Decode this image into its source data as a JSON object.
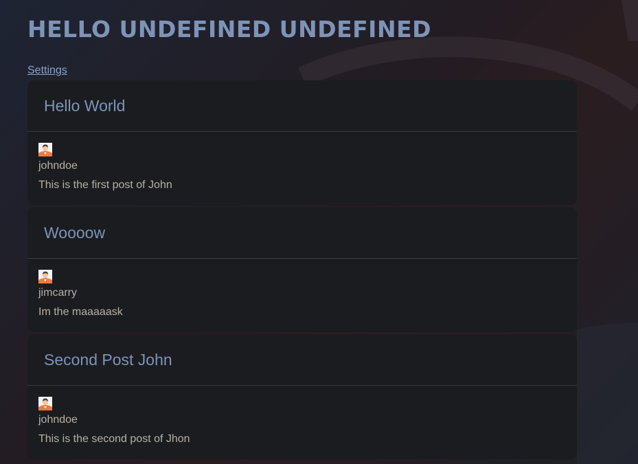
{
  "header": {
    "title": "HELLO UNDEFINED UNDEFINED",
    "settings_link": "Settings"
  },
  "posts": [
    {
      "title": "Hello World",
      "username": "johndoe",
      "content": "This is the first post of John",
      "avatar_icon": "user-avatar-icon"
    },
    {
      "title": "Woooow",
      "username": "jimcarry",
      "content": "Im the maaaaask",
      "avatar_icon": "user-avatar-icon"
    },
    {
      "title": "Second Post John",
      "username": "johndoe",
      "content": "This is the second post of Jhon",
      "avatar_icon": "user-avatar-icon"
    }
  ],
  "colors": {
    "accent": "#7d94b8",
    "card_background": "#1b1c1f",
    "body_text": "#b7b1a8",
    "avatar_orange": "#f07a3e"
  }
}
